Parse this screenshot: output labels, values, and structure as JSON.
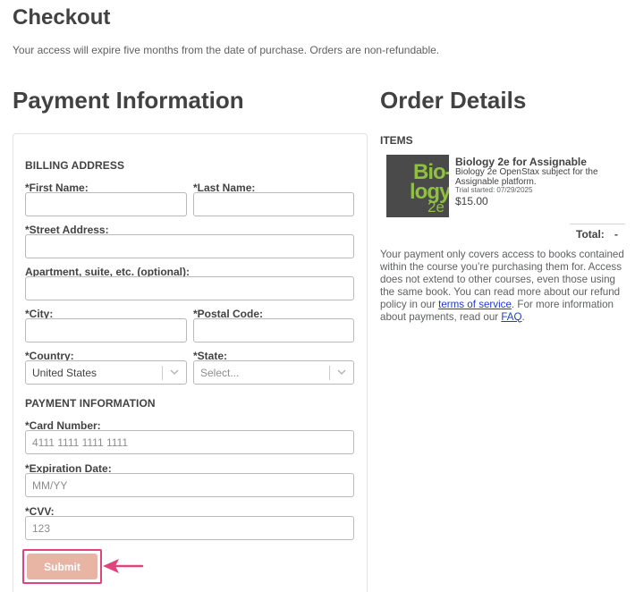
{
  "page": {
    "title": "Checkout",
    "subtitle": "Your access will expire five months from the date of purchase. Orders are non-refundable."
  },
  "payment": {
    "heading": "Payment Information",
    "billing_title": "BILLING ADDRESS",
    "first_name_label": "*First Name:",
    "last_name_label": "*Last Name:",
    "street_label": "*Street Address:",
    "apt_label": "Apartment, suite, etc. (optional):",
    "city_label": "*City:",
    "postal_label": "*Postal Code:",
    "country_label": "*Country:",
    "country_value": "United States",
    "state_label": "*State:",
    "state_placeholder": "Select...",
    "payment_title": "PAYMENT INFORMATION",
    "card_label": "*Card Number:",
    "card_placeholder": "4111 1111 1111 1111",
    "exp_label": "*Expiration Date:",
    "exp_placeholder": "MM/YY",
    "cvv_label": "*CVV:",
    "cvv_placeholder": "123",
    "submit_label": "Submit"
  },
  "order": {
    "heading": "Order Details",
    "items_title": "ITEMS",
    "item": {
      "cover_text_1": "Bio-",
      "cover_text_2": "logy",
      "cover_text_3": "2e",
      "name": "Biology 2e for Assignable",
      "description": "Biology 2e OpenStax subject for the Assignable platform.",
      "trial": "Trial started: 07/29/2025",
      "price": "$15.00"
    },
    "total_label": "Total:",
    "total_value": "-",
    "notice_text": "Your payment only covers access to books contained within the course you’re purchasing them for. Access does not extend to other courses, even those using the same book. You can read more about our refund policy in our ",
    "terms_link": "terms of service",
    "notice_text_2": ". For more information about payments, read our ",
    "faq_link": "FAQ",
    "notice_end": "."
  },
  "colors": {
    "submit_bg": "#e8b5a4",
    "highlight": "#e0447d",
    "link": "#1e3ec6",
    "cover_bg": "#4a4a4a",
    "cover_text": "#8fc043"
  },
  "icons": {
    "select_chevron": "chevron-down-icon",
    "annotation_arrow": "arrow-left-icon"
  }
}
